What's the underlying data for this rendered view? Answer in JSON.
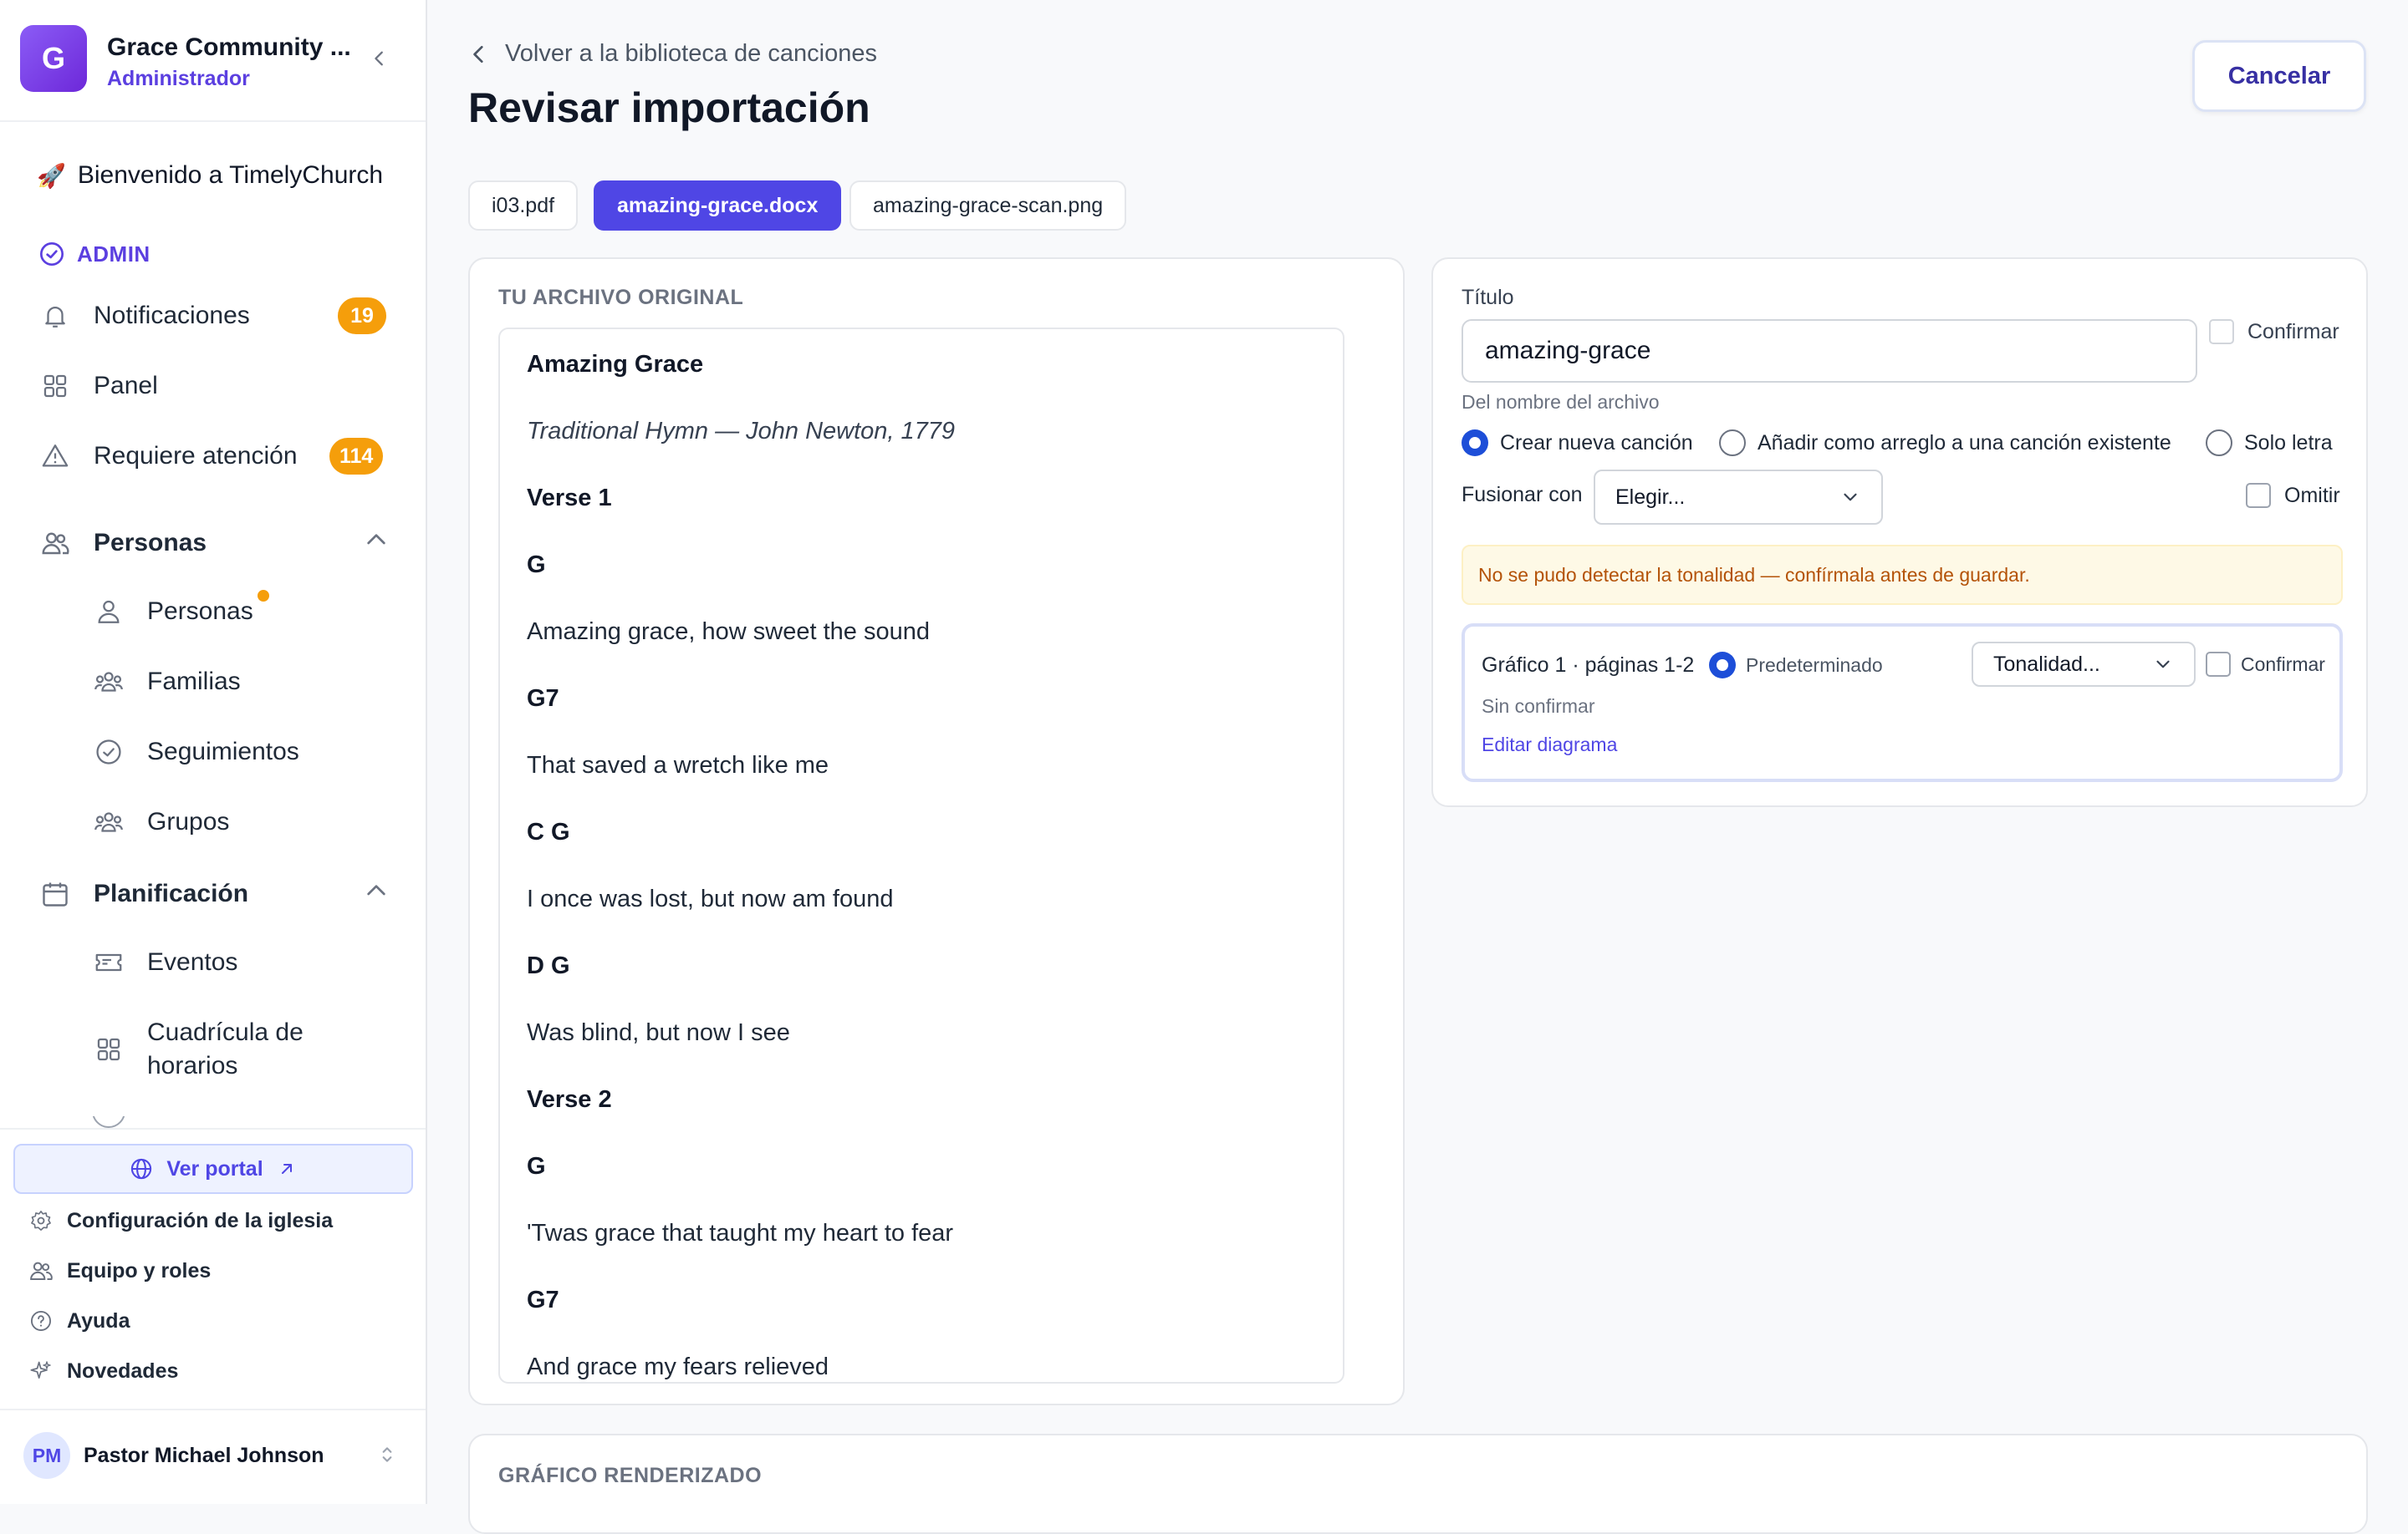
{
  "sidebar": {
    "org_initial": "G",
    "org_name": "Grace Community ...",
    "org_role": "Administrador",
    "welcome": "Bienvenido a TimelyChurch",
    "admin_label": "ADMIN",
    "items": [
      {
        "label": "Notificaciones",
        "badge": "19",
        "icon": "bell-icon"
      },
      {
        "label": "Panel",
        "icon": "grid-icon"
      },
      {
        "label": "Requiere atención",
        "badge": "114",
        "icon": "warning-icon"
      }
    ],
    "groups": [
      {
        "label": "Personas",
        "icon": "people-icon",
        "children": [
          {
            "label": "Personas",
            "icon": "person-icon"
          },
          {
            "label": "Familias",
            "icon": "family-icon"
          },
          {
            "label": "Seguimientos",
            "icon": "check-circle-icon"
          },
          {
            "label": "Grupos",
            "icon": "group-icon"
          }
        ]
      },
      {
        "label": "Planificación",
        "icon": "calendar-icon",
        "children": [
          {
            "label": "Eventos",
            "icon": "ticket-icon"
          },
          {
            "label": "Cuadrícula de horarios",
            "label_line1": "Cuadrícula de",
            "label_line2": "horarios",
            "icon": "grid-icon"
          }
        ]
      }
    ],
    "portal_label": "Ver portal",
    "footer_links": [
      {
        "label": "Configuración de la iglesia",
        "icon": "gear-icon"
      },
      {
        "label": "Equipo y roles",
        "icon": "team-icon"
      },
      {
        "label": "Ayuda",
        "icon": "help-icon"
      },
      {
        "label": "Novedades",
        "icon": "sparkle-icon"
      }
    ],
    "user_initials": "PM",
    "user_name": "Pastor Michael Johnson"
  },
  "header": {
    "back_label": "Volver a la biblioteca de canciones",
    "title": "Revisar importación",
    "cancel_label": "Cancelar"
  },
  "file_tabs": [
    "i03.pdf",
    "amazing-grace.docx",
    "amazing-grace-scan.png"
  ],
  "active_tab": "amazing-grace.docx",
  "original": {
    "heading": "TU ARCHIVO ORIGINAL",
    "lines": [
      "Amazing Grace",
      "Traditional Hymn — John Newton, 1779",
      "Verse 1",
      "G",
      "Amazing grace, how sweet the sound",
      "G7",
      "That saved a wretch like me",
      "C G",
      "I once was lost, but now am found",
      "D G",
      "Was blind, but now I see",
      "Verse 2",
      "G",
      "'Twas grace that taught my heart to fear",
      "G7",
      "And grace my fears relieved"
    ]
  },
  "form": {
    "title_label": "Título",
    "title_value": "amazing-grace",
    "confirm_label": "Confirmar",
    "title_hint": "Del nombre del archivo",
    "radio_options": [
      "Crear nueva canción",
      "Añadir como arreglo a una canción existente",
      "Solo letra"
    ],
    "radio_selected": "Crear nueva canción",
    "merge_label": "Fusionar con",
    "merge_value": "Elegir...",
    "omit_label": "Omitir",
    "warning": "No se pudo detectar la tonalidad — confírmala antes de guardar.",
    "chart": {
      "title": "Gráfico 1 · páginas 1-2",
      "default_label": "Predeterminado",
      "key_select": "Tonalidad...",
      "confirm_label": "Confirmar",
      "status": "Sin confirmar",
      "edit_link": "Editar diagrama"
    }
  },
  "rendered": {
    "heading": "GRÁFICO RENDERIZADO"
  },
  "colors": {
    "accent": "#4F46E5",
    "badge": "#F59E0B",
    "radio": "#1D4ED8",
    "warning_bg": "#FEF9E6",
    "warning_text": "#B45309"
  }
}
